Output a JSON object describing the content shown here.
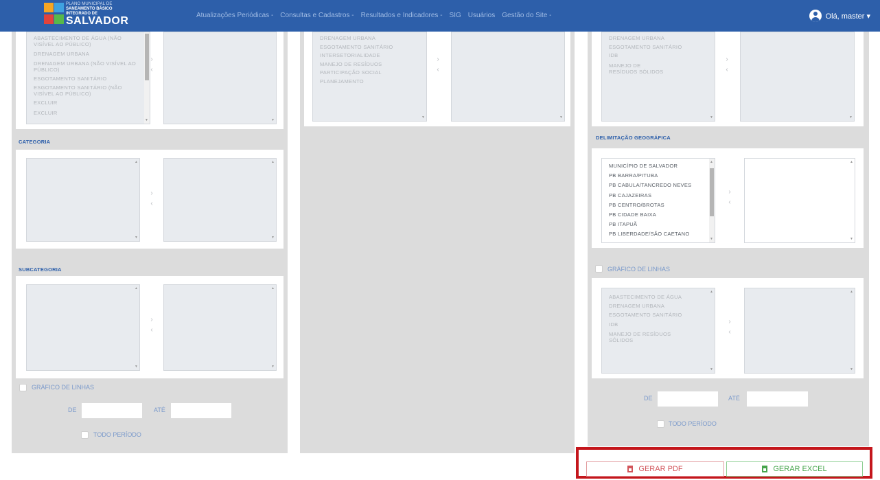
{
  "header": {
    "logo_line1": "PLANO MUNICIPAL DE",
    "logo_line2": "SANEAMENTO BÁSICO",
    "logo_line3": "INTEGRADO DE",
    "logo_line4": "SALVADOR",
    "nav": [
      "Atualizações Periódicas -",
      "Consultas e Cadastros -",
      "Resultados e Indicadores -",
      "SIG",
      "Usuários",
      "Gestão do Site -"
    ],
    "user_greeting": "Olá, master ▾",
    "bar_color": "#2d5faa"
  },
  "col1": {
    "list_items": [
      "ABASTECIMENTO DE ÁGUA (NÃO VISÍVEL AO PÚBLICO)",
      "DRENAGEM URBANA",
      "DRENAGEM URBANA (NÃO VISÍVEL AO PÚBLICO)",
      "ESGOTAMENTO SANITÁRIO",
      "ESGOTAMENTO SANITÁRIO (NÃO VISÍVEL AO PÚBLICO)",
      "EXCLUIR",
      "EXCLUIR"
    ],
    "categoria_label": "CATEGORIA",
    "subcategoria_label": "SUBCATEGORIA",
    "grafico_label": "GRÁFICO DE LINHAS",
    "de_label": "DE",
    "ate_label": "ATÉ",
    "todo_periodo_label": "TODO PERÍODO"
  },
  "col2": {
    "list_items": [
      "DRENAGEM URBANA",
      "ESGOTAMENTO SANITÁRIO",
      "INTERSETORIALIDADE",
      "MANEJO DE RESÍDUOS",
      "PARTICIPAÇÃO SOCIAL",
      "PLANEJAMENTO"
    ]
  },
  "col3": {
    "top_list_items": [
      "DRENAGEM URBANA",
      "ESGOTAMENTO SANITÁRIO",
      "IDB",
      "MANEJO DE RESÍDUOS SÓLIDOS"
    ],
    "delimitacao_label": "DELIMITAÇÃO GEOGRÁFICA",
    "delimitacao_items": [
      "MUNICÍPIO DE SALVADOR",
      "PB BARRA/PITUBA",
      "PB CABULA/TANCREDO NEVES",
      "PB CAJAZEIRAS",
      "PB CENTRO/BROTAS",
      "PB CIDADE BAIXA",
      "PB ITAPUÃ",
      "PB LIBERDADE/SÃO CAETANO"
    ],
    "grafico_label": "GRÁFICO DE LINHAS",
    "grafico_items": [
      "ABASTECIMENTO DE ÁGUA",
      "DRENAGEM URBANA",
      "ESGOTAMENTO SANITÁRIO",
      "IDB",
      "MANEJO DE RESÍDUOS SÓLIDOS"
    ],
    "de_label": "DE",
    "ate_label": "ATÉ",
    "todo_periodo_label": "TODO PERÍODO"
  },
  "actions": {
    "pdf_label": "GERAR PDF",
    "excel_label": "GERAR EXCEL",
    "pdf_color": "#d2555b",
    "excel_color": "#46a54c",
    "highlight_color": "#c4161c"
  }
}
